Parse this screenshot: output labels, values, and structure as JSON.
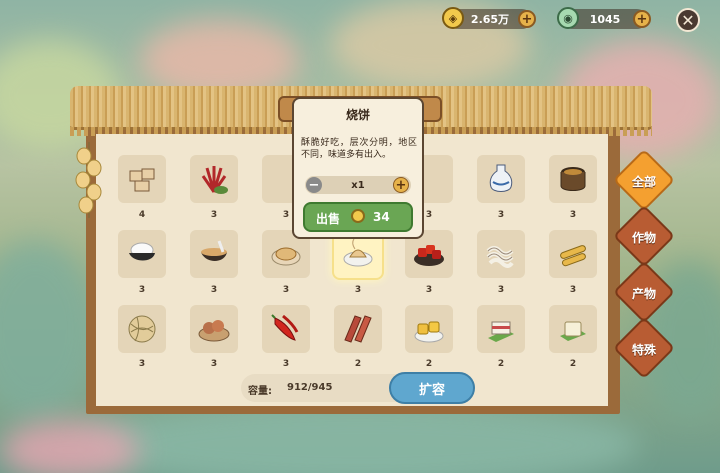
{
  "currency": {
    "coins": "2.65万",
    "jade": "1045"
  },
  "tooltip": {
    "title": "烧饼",
    "description": "酥脆好吃，层次分明，地区不同，味道多有出入。",
    "quantity": "x1",
    "sell_label": "出售",
    "sell_price": "34"
  },
  "tabs": [
    {
      "label": "全部",
      "active": true
    },
    {
      "label": "作物",
      "active": false
    },
    {
      "label": "产物",
      "active": false
    },
    {
      "label": "特殊",
      "active": false
    }
  ],
  "inventory": {
    "rows": [
      [
        {
          "item": "tofu-block-icon",
          "count": "4"
        },
        {
          "item": "red-flower-bundle-icon",
          "count": "3"
        },
        {
          "item": "hidden-under-tooltip",
          "count": "3"
        },
        {
          "item": "hidden-under-tooltip",
          "count": ""
        },
        {
          "item": "hidden-under-tooltip",
          "count": "3"
        },
        {
          "item": "porcelain-vase-icon",
          "count": "3"
        },
        {
          "item": "sauce-jar-icon",
          "count": "3"
        }
      ],
      [
        {
          "item": "rice-bowl-icon",
          "count": "3"
        },
        {
          "item": "soup-bowl-icon",
          "count": "3"
        },
        {
          "item": "flatbread-plate-icon",
          "count": "3"
        },
        {
          "item": "shaobing-icon",
          "count": "3",
          "selected": true
        },
        {
          "item": "braised-meat-icon",
          "count": "3"
        },
        {
          "item": "noodles-icon",
          "count": "3"
        },
        {
          "item": "spring-rolls-icon",
          "count": "3"
        }
      ],
      [
        {
          "item": "yarn-ball-icon",
          "count": "3"
        },
        {
          "item": "bun-basket-icon",
          "count": "3"
        },
        {
          "item": "red-chili-icon",
          "count": "3"
        },
        {
          "item": "bacon-strips-icon",
          "count": "2"
        },
        {
          "item": "fried-tofu-icon",
          "count": "2"
        },
        {
          "item": "cake-slice-icon",
          "count": "2"
        },
        {
          "item": "tofu-plate-icon",
          "count": "2"
        }
      ]
    ]
  },
  "capacity": {
    "label": "容量:",
    "value": "912/945"
  },
  "expand_label": "扩容",
  "colors": {
    "panel_frame": "#9b6a3a",
    "panel_inner": "#f1e6cf",
    "slot": "#e4d5b8",
    "tab_active": "#f4a030",
    "tab_inactive": "#b85c33",
    "sell_green": "#6aa654",
    "expand_blue": "#5fa7cf"
  }
}
